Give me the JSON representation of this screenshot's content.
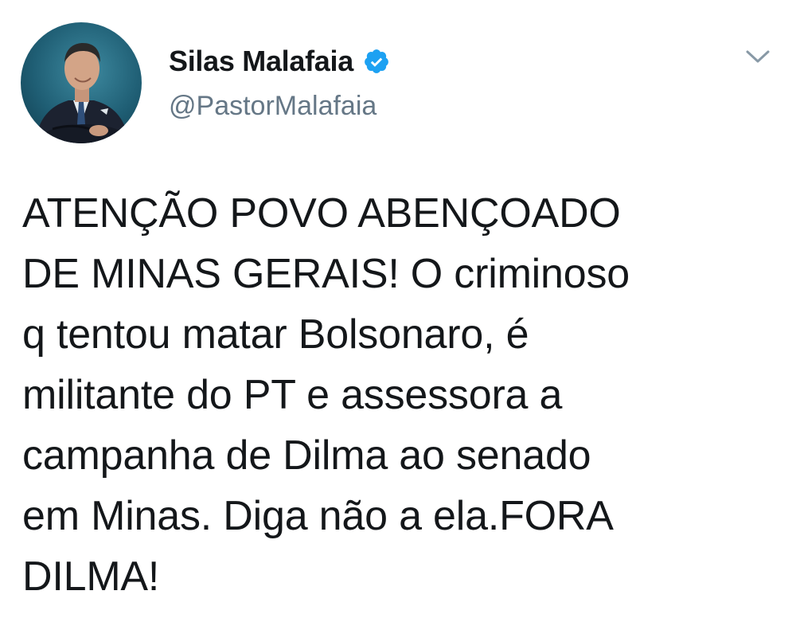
{
  "tweet": {
    "author": {
      "display_name": "Silas Malafaia",
      "handle": "@PastorMalafaia",
      "verified": true
    },
    "text": "ATENÇÃO POVO ABENÇOADO\nDE MINAS GERAIS! O criminoso\nq tentou matar Bolsonaro, é\nmilitante do PT e assessora a\ncampanha de Dilma ao senado\nem Minas. Diga não a ela.FORA\nDILMA!"
  },
  "icons": {
    "verified": "verified-badge-icon",
    "menu": "chevron-down-icon"
  },
  "colors": {
    "text": "#14171a",
    "secondary_text": "#657786",
    "verified_blue": "#1da1f2"
  }
}
